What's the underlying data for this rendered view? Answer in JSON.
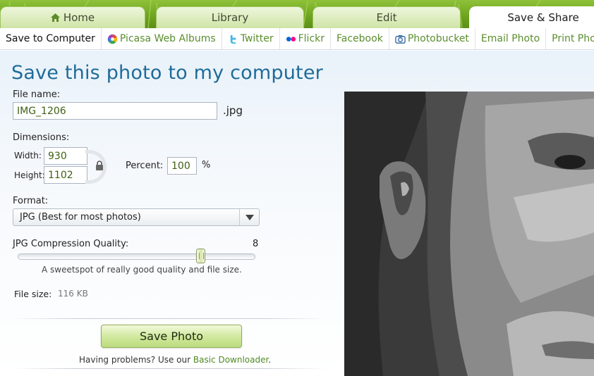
{
  "main_tabs": [
    {
      "label": "Home",
      "icon": "home-icon",
      "active": false
    },
    {
      "label": "Library",
      "active": false
    },
    {
      "label": "Edit",
      "active": false
    },
    {
      "label": "Save & Share",
      "active": true
    }
  ],
  "sub_nav": [
    {
      "label": "Save to Computer",
      "active": true
    },
    {
      "label": "Picasa Web Albums",
      "icon": "picasa-icon"
    },
    {
      "label": "Twitter",
      "icon": "twitter-icon"
    },
    {
      "label": "Flickr",
      "icon": "flickr-icon"
    },
    {
      "label": "Facebook"
    },
    {
      "label": "Photobucket",
      "icon": "photobucket-icon"
    },
    {
      "label": "Email Photo"
    },
    {
      "label": "Print Pho"
    }
  ],
  "page": {
    "title": "Save this photo to my computer"
  },
  "file_name": {
    "label": "File name:",
    "value": "IMG_1206",
    "extension": ".jpg"
  },
  "dimensions": {
    "label": "Dimensions:",
    "width_label": "Width:",
    "width_value": "930",
    "height_label": "Height:",
    "height_value": "1102",
    "percent_label": "Percent:",
    "percent_value": "100",
    "percent_unit": "%"
  },
  "format": {
    "label": "Format:",
    "selected": "JPG  (Best for most photos)"
  },
  "quality": {
    "label": "JPG Compression Quality:",
    "value": "8",
    "slider_fraction": 0.77,
    "hint": "A sweetspot of really good quality and file size."
  },
  "file_size": {
    "label": "File size:",
    "value": "116 KB"
  },
  "actions": {
    "save_label": "Save Photo",
    "problems_text": "Having problems? Use our ",
    "downloader_link": "Basic Downloader",
    "problems_end": "."
  },
  "colors": {
    "accent_green": "#5b8e2e",
    "title_blue": "#1f6b99",
    "top_bar": "#6fa51f"
  }
}
